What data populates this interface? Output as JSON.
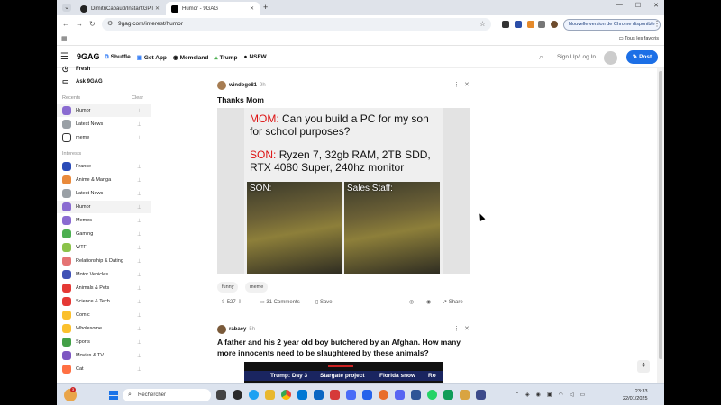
{
  "browser": {
    "tabs": [
      {
        "label": "DimitriCabaud/InstantGPT"
      },
      {
        "label": "Humor - 9GAG"
      }
    ],
    "url": "9gag.com/interest/humor",
    "update_button": "Nouvelle version de Chrome disponible",
    "all_favorites": "Tous les favoris"
  },
  "header": {
    "logo": "9GAG",
    "nav": [
      {
        "label": "Shuffle",
        "icon": "shuffle-icon"
      },
      {
        "label": "Get App",
        "icon": "app-icon"
      },
      {
        "label": "Memeland",
        "icon": "memeland-icon"
      },
      {
        "label": "Trump",
        "icon": "trump-icon"
      },
      {
        "label": "NSFW",
        "icon": "nsfw-icon"
      }
    ],
    "login": "Sign Up/Log In",
    "post_button": "Post"
  },
  "sidebar": {
    "top_items": [
      {
        "label": "Fresh",
        "icon": "clock-icon"
      },
      {
        "label": "Ask 9GAG",
        "icon": "chat-icon"
      }
    ],
    "recents_title": "Recents",
    "clear_label": "Clear",
    "recents": [
      {
        "label": "Humor",
        "color": "#8a6bd1"
      },
      {
        "label": "Latest News",
        "color": "#9aa0a6"
      },
      {
        "label": "meme",
        "color": "#ffffff"
      }
    ],
    "interests_title": "Interests",
    "interests": [
      {
        "label": "France",
        "color": "#2a4bb8"
      },
      {
        "label": "Anime & Manga",
        "color": "#e98a3b"
      },
      {
        "label": "Latest News",
        "color": "#9aa0a6"
      },
      {
        "label": "Humor",
        "color": "#8a6bd1"
      },
      {
        "label": "Memes",
        "color": "#8a6bd1"
      },
      {
        "label": "Gaming",
        "color": "#4caf50"
      },
      {
        "label": "WTF",
        "color": "#8bc34a"
      },
      {
        "label": "Relationship & Dating",
        "color": "#e57373"
      },
      {
        "label": "Motor Vehicles",
        "color": "#3f51b5"
      },
      {
        "label": "Animals & Pets",
        "color": "#e53935"
      },
      {
        "label": "Science & Tech",
        "color": "#e53935"
      },
      {
        "label": "Comic",
        "color": "#fbc02d"
      },
      {
        "label": "Wholesome",
        "color": "#fbc02d"
      },
      {
        "label": "Sports",
        "color": "#43a047"
      },
      {
        "label": "Movies & TV",
        "color": "#7e57c2"
      },
      {
        "label": "Cat",
        "color": "#ff7043"
      }
    ]
  },
  "post1": {
    "author": "windoge81",
    "age": "9h",
    "title": "Thanks Mom",
    "meme_mom_label": "MOM:",
    "meme_mom_text": "Can you build a PC for my son for school purposes?",
    "meme_son_label": "SON:",
    "meme_son_text": "Ryzen 7, 32gb RAM, 2TB SDD, RTX 4080 Super, 240hz monitor",
    "panel_left": "SON:",
    "panel_right": "Sales Staff:",
    "tags": [
      "funny",
      "meme"
    ],
    "upvotes": "527",
    "comments": "31 Comments",
    "save": "Save",
    "share": "Share"
  },
  "post2": {
    "author": "rabaey",
    "age": "5h",
    "title": "A father and his 2 year old boy butchered by an Afghan. How many more innocents need to be slaughtered by these animals?",
    "thumb_texts": [
      "Trump: Day 3",
      "Stargate project",
      "Florida snow",
      "Ro"
    ]
  },
  "taskbar": {
    "badge": "3",
    "search_placeholder": "Rechercher",
    "time": "23:33",
    "date": "22/01/2025"
  }
}
